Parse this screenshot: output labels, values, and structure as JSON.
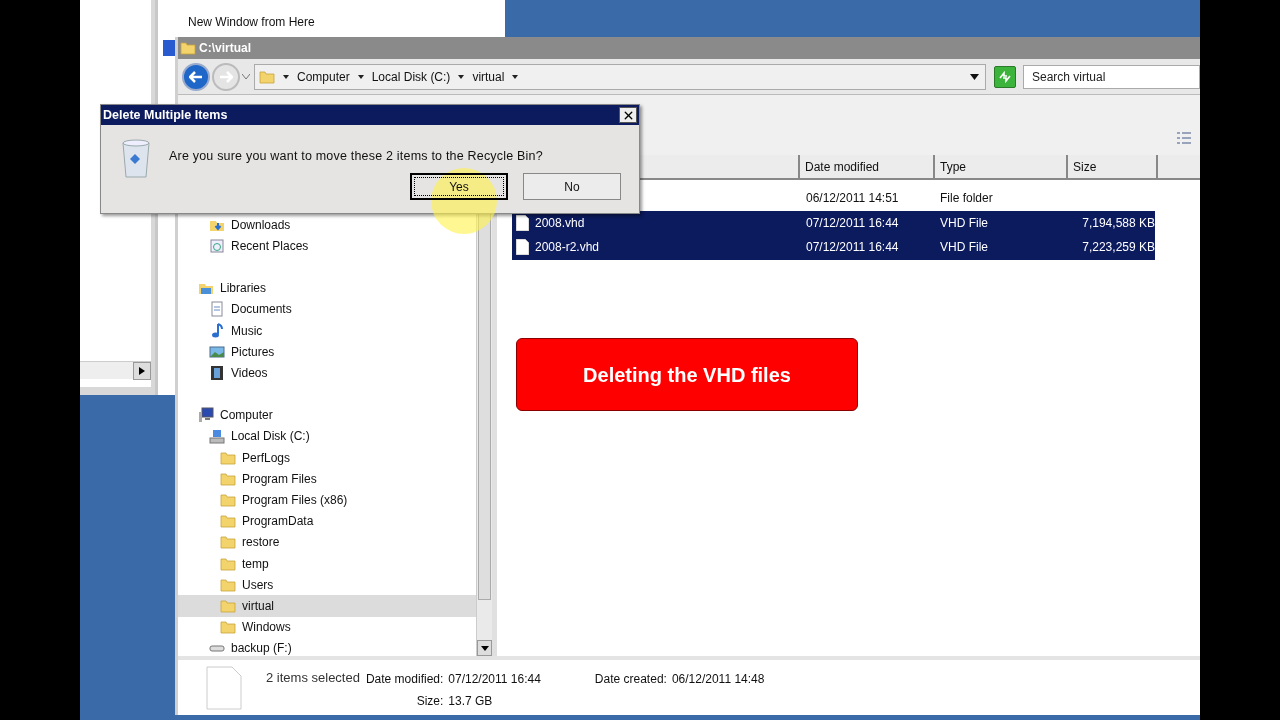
{
  "background_window": {
    "menu_item": "New Window from Here"
  },
  "explorer": {
    "title": "C:\\virtual",
    "breadcrumb": [
      "Computer",
      "Local Disk (C:)",
      "virtual"
    ],
    "search": {
      "placeholder": "Search virtual"
    },
    "nav": {
      "favorites": [
        {
          "label": "Downloads",
          "kind": "downloads",
          "selected": false
        },
        {
          "label": "Recent Places",
          "kind": "recent",
          "selected": false
        }
      ],
      "tree": [
        {
          "label": "Libraries",
          "kind": "library",
          "selected": false,
          "children": [
            {
              "label": "Documents",
              "kind": "documents",
              "selected": false
            },
            {
              "label": "Music",
              "kind": "music",
              "selected": false
            },
            {
              "label": "Pictures",
              "kind": "pictures",
              "selected": false
            },
            {
              "label": "Videos",
              "kind": "videos",
              "selected": false
            }
          ]
        },
        {
          "label": "Computer",
          "kind": "computer",
          "selected": false,
          "children": [
            {
              "label": "Local Disk (C:)",
              "kind": "drive",
              "selected": false,
              "children": [
                {
                  "label": "PerfLogs",
                  "kind": "folder",
                  "selected": false
                },
                {
                  "label": "Program Files",
                  "kind": "folder",
                  "selected": false
                },
                {
                  "label": "Program Files (x86)",
                  "kind": "folder",
                  "selected": false
                },
                {
                  "label": "ProgramData",
                  "kind": "folder",
                  "selected": false
                },
                {
                  "label": "restore",
                  "kind": "folder",
                  "selected": false
                },
                {
                  "label": "temp",
                  "kind": "folder",
                  "selected": false
                },
                {
                  "label": "Users",
                  "kind": "folder",
                  "selected": false
                },
                {
                  "label": "virtual",
                  "kind": "folder",
                  "selected": true
                },
                {
                  "label": "Windows",
                  "kind": "folder",
                  "selected": false
                }
              ]
            },
            {
              "label": "backup (F:)",
              "kind": "removable",
              "selected": false
            }
          ]
        }
      ]
    },
    "columns": [
      "Date modified",
      "Type",
      "Size"
    ],
    "rows": [
      {
        "date": "06/12/2011 14:51",
        "type": "File folder",
        "size": "",
        "selected": false
      },
      {
        "name": "2008.vhd",
        "date": "07/12/2011 16:44",
        "type": "VHD File",
        "size": "7,194,588 KB",
        "selected": true
      },
      {
        "name": "2008-r2.vhd",
        "date": "07/12/2011 16:44",
        "type": "VHD File",
        "size": "7,223,259 KB",
        "selected": true
      }
    ],
    "details": {
      "summary": "2 items selected",
      "columns": [
        [
          {
            "label": "Date modified:",
            "value": "07/12/2011 16:44"
          },
          {
            "label": "Size:",
            "value": "13.7 GB"
          }
        ],
        [
          {
            "label": "Date created:",
            "value": "06/12/2011 14:48"
          }
        ]
      ]
    }
  },
  "banner": "Deleting the VHD files",
  "dialog": {
    "title": "Delete Multiple Items",
    "message": "Are you sure you want to move these 2 items to the Recycle Bin?",
    "buttons": [
      {
        "label": "Yes",
        "focused": true
      },
      {
        "label": "No",
        "focused": false
      }
    ]
  }
}
